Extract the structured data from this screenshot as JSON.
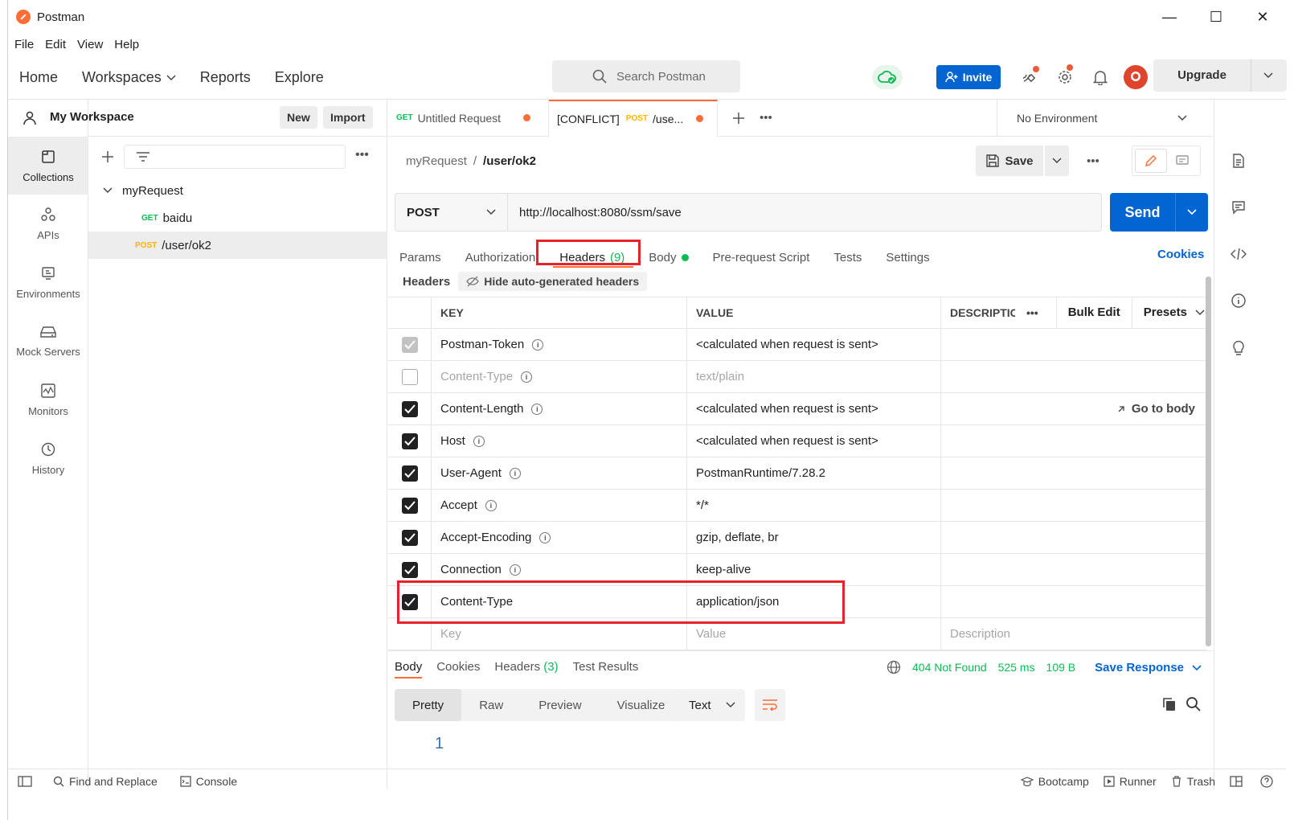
{
  "app": {
    "title": "Postman"
  },
  "window_controls": {
    "minimize": "—",
    "maximize": "☐",
    "close": "✕"
  },
  "menu": [
    "File",
    "Edit",
    "View",
    "Help"
  ],
  "nav": {
    "home": "Home",
    "workspaces": "Workspaces",
    "reports": "Reports",
    "explore": "Explore"
  },
  "search": {
    "placeholder": "Search Postman"
  },
  "header": {
    "invite": "Invite",
    "upgrade": "Upgrade"
  },
  "left_rail": [
    {
      "label": "Collections",
      "icon": "collections-icon"
    },
    {
      "label": "APIs",
      "icon": "apis-icon"
    },
    {
      "label": "Environments",
      "icon": "environments-icon"
    },
    {
      "label": "Mock Servers",
      "icon": "mock-servers-icon"
    },
    {
      "label": "Monitors",
      "icon": "monitors-icon"
    },
    {
      "label": "History",
      "icon": "history-icon"
    }
  ],
  "sidebar": {
    "workspace": "My Workspace",
    "new_btn": "New",
    "import_btn": "Import",
    "collection": "myRequest",
    "requests": [
      {
        "method": "GET",
        "name": "baidu"
      },
      {
        "method": "POST",
        "name": "/user/ok2"
      }
    ]
  },
  "tabs": [
    {
      "method": "GET",
      "name": "Untitled Request"
    },
    {
      "prefix": "[CONFLICT]",
      "method": "POST",
      "name": "/use..."
    }
  ],
  "environment": "No Environment",
  "breadcrumb": {
    "parent": "myRequest",
    "separator": "/",
    "current": "/user/ok2"
  },
  "save_label": "Save",
  "request": {
    "method": "POST",
    "url": "http://localhost:8080/ssm/save",
    "send": "Send"
  },
  "request_tabs": {
    "params": "Params",
    "authorization": "Authorization",
    "headers": "Headers",
    "headers_count": "(9)",
    "body": "Body",
    "prerequest": "Pre-request Script",
    "tests": "Tests",
    "settings": "Settings",
    "cookies": "Cookies"
  },
  "headers_sub": {
    "title": "Headers",
    "hide": "Hide auto-generated headers"
  },
  "table": {
    "key_col": "KEY",
    "value_col": "VALUE",
    "desc_col": "DESCRIPTIC",
    "bulk_edit": "Bulk Edit",
    "presets": "Presets",
    "go_to_body": "Go to body",
    "rows": [
      {
        "key": "Postman-Token",
        "value": "<calculated when request is sent>",
        "state": "grey"
      },
      {
        "key": "Content-Type",
        "value": "text/plain",
        "state": "empty"
      },
      {
        "key": "Content-Length",
        "value": "<calculated when request is sent>",
        "state": "checked"
      },
      {
        "key": "Host",
        "value": "<calculated when request is sent>",
        "state": "checked"
      },
      {
        "key": "User-Agent",
        "value": "PostmanRuntime/7.28.2",
        "state": "checked"
      },
      {
        "key": "Accept",
        "value": "*/*",
        "state": "checked"
      },
      {
        "key": "Accept-Encoding",
        "value": "gzip, deflate, br",
        "state": "checked"
      },
      {
        "key": "Connection",
        "value": "keep-alive",
        "state": "checked"
      },
      {
        "key": "Content-Type",
        "value": "application/json",
        "state": "checked"
      }
    ],
    "placeholder": {
      "key": "Key",
      "value": "Value",
      "desc": "Description"
    }
  },
  "response": {
    "tabs": {
      "body": "Body",
      "cookies": "Cookies",
      "headers": "Headers",
      "headers_count": "(3)",
      "tests": "Test Results"
    },
    "status": "404 Not Found",
    "time": "525 ms",
    "size": "109 B",
    "save": "Save Response",
    "formats": [
      "Pretty",
      "Raw",
      "Preview",
      "Visualize"
    ],
    "lang": "Text",
    "line": "1"
  },
  "footer": {
    "find": "Find and Replace",
    "console": "Console",
    "bootcamp": "Bootcamp",
    "runner": "Runner",
    "trash": "Trash"
  },
  "colors": {
    "accent": "#ff6c37",
    "primary": "#0265d2",
    "success": "#0cbb52",
    "highlight": "#e8222b"
  }
}
